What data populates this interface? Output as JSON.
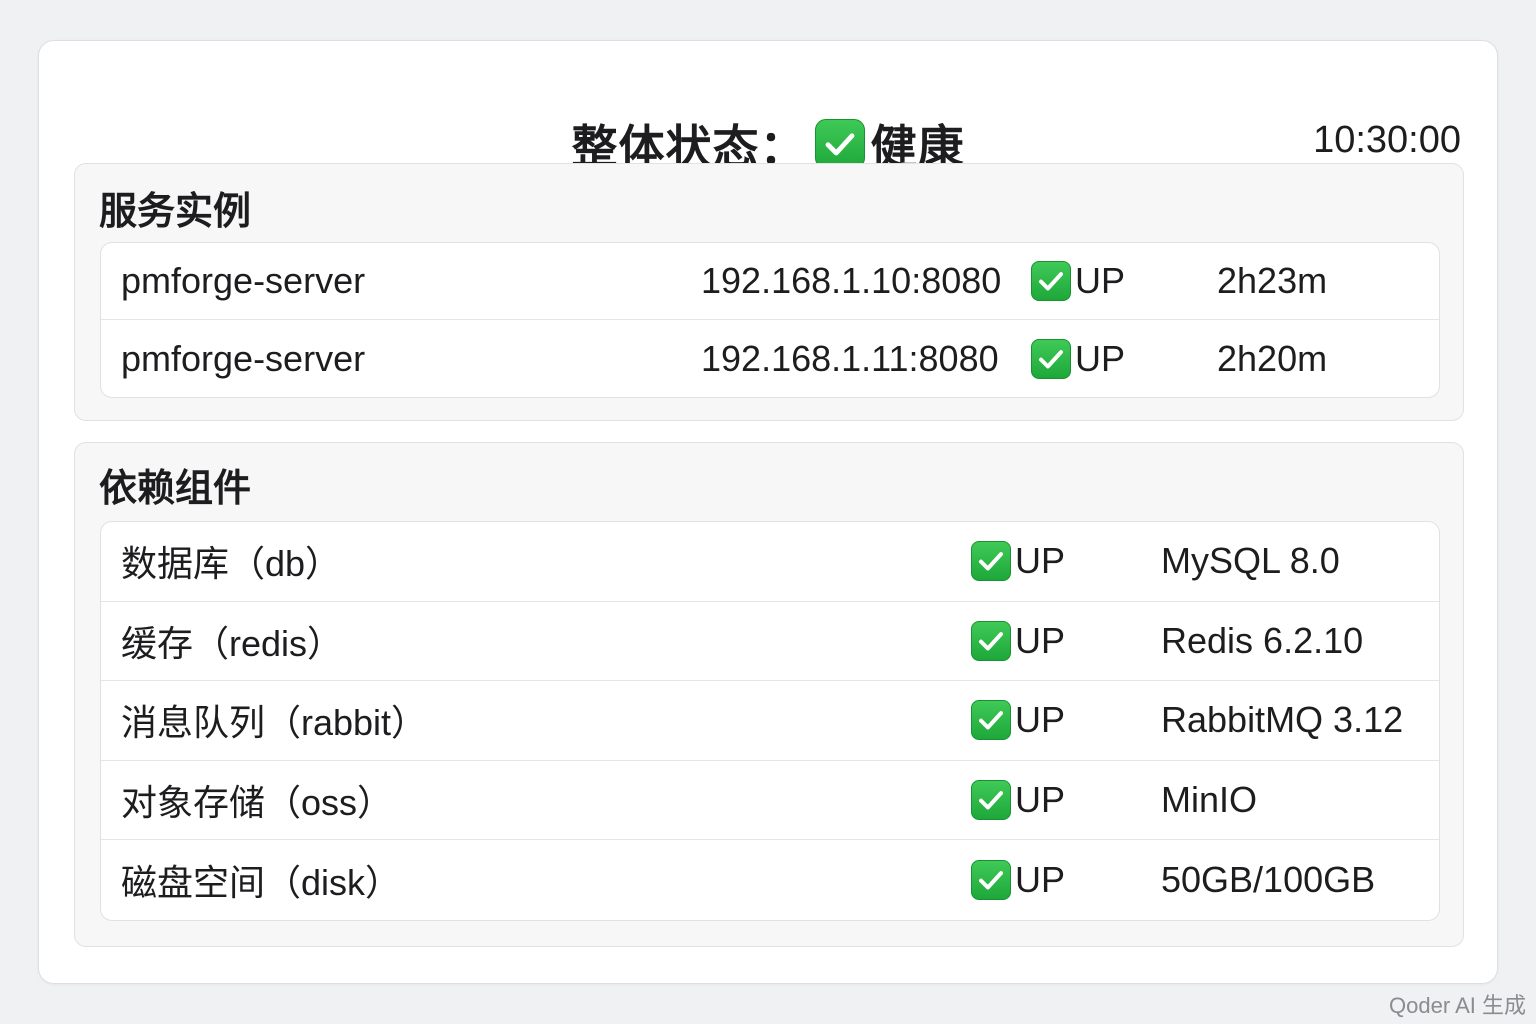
{
  "header": {
    "title_label": "整体状态：",
    "status_icon": "check-icon",
    "status_text": "健康",
    "time": "10:30:00"
  },
  "service_section": {
    "title": "服务实例",
    "rows": [
      {
        "name": "pmforge-server",
        "address": "192.168.1.10:8080",
        "status_icon": "check-icon",
        "status": "UP",
        "uptime": "2h23m"
      },
      {
        "name": "pmforge-server",
        "address": "192.168.1.11:8080",
        "status_icon": "check-icon",
        "status": "UP",
        "uptime": "2h20m"
      }
    ]
  },
  "dependency_section": {
    "title": "依赖组件",
    "rows": [
      {
        "name": "数据库（db）",
        "status_icon": "check-icon",
        "status": "UP",
        "detail": "MySQL 8.0"
      },
      {
        "name": "缓存（redis）",
        "status_icon": "check-icon",
        "status": "UP",
        "detail": "Redis 6.2.10"
      },
      {
        "name": "消息队列（rabbit）",
        "status_icon": "check-icon",
        "status": "UP",
        "detail": "RabbitMQ 3.12"
      },
      {
        "name": "对象存储（oss）",
        "status_icon": "check-icon",
        "status": "UP",
        "detail": "MinIO"
      },
      {
        "name": "磁盘空间（disk）",
        "status_icon": "check-icon",
        "status": "UP",
        "detail": "50GB/100GB"
      }
    ]
  },
  "watermark": "Qoder AI 生成",
  "colors": {
    "status_ok": "#28b443",
    "background": "#f0f1f2",
    "card": "#ffffff",
    "section": "#f7f7f8"
  }
}
